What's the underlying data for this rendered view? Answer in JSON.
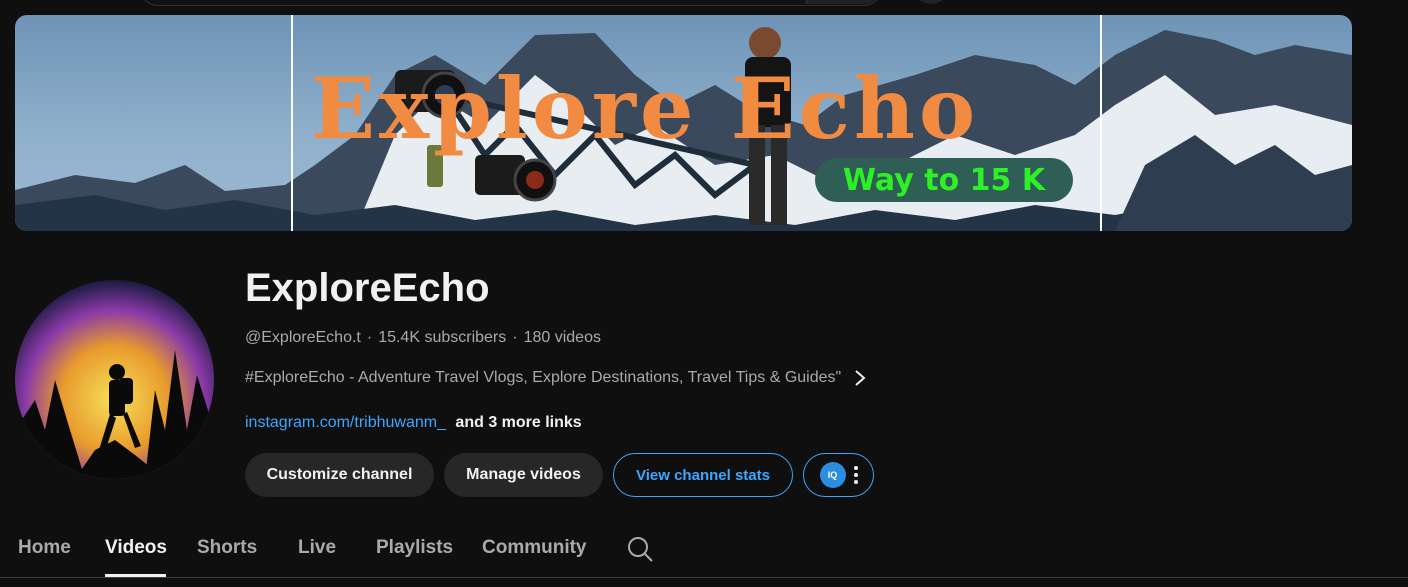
{
  "banner": {
    "title": "Explore Echo",
    "pill_text": "Way to 15 K"
  },
  "channel": {
    "name": "ExploreEcho",
    "handle": "@ExploreEcho.t",
    "separator": "·",
    "subscribers": "15.4K subscribers",
    "videos": "180 videos",
    "description": "#ExploreEcho - Adventure Travel Vlogs, Explore Destinations, Travel Tips & Guides\"",
    "link_text": "instagram.com/tribhuwanm_",
    "more_links": "and 3 more links"
  },
  "actions": {
    "customize": "Customize channel",
    "manage": "Manage videos",
    "stats": "View channel stats",
    "extension_badge": "IQ"
  },
  "tabs": {
    "home": "Home",
    "videos": "Videos",
    "shorts": "Shorts",
    "live": "Live",
    "playlists": "Playlists",
    "community": "Community",
    "active": "Videos"
  },
  "colors": {
    "accent_blue": "#3ea6ff",
    "banner_title": "#f28b42",
    "banner_pill_text": "#2ef026",
    "background": "#0f0f0f"
  }
}
